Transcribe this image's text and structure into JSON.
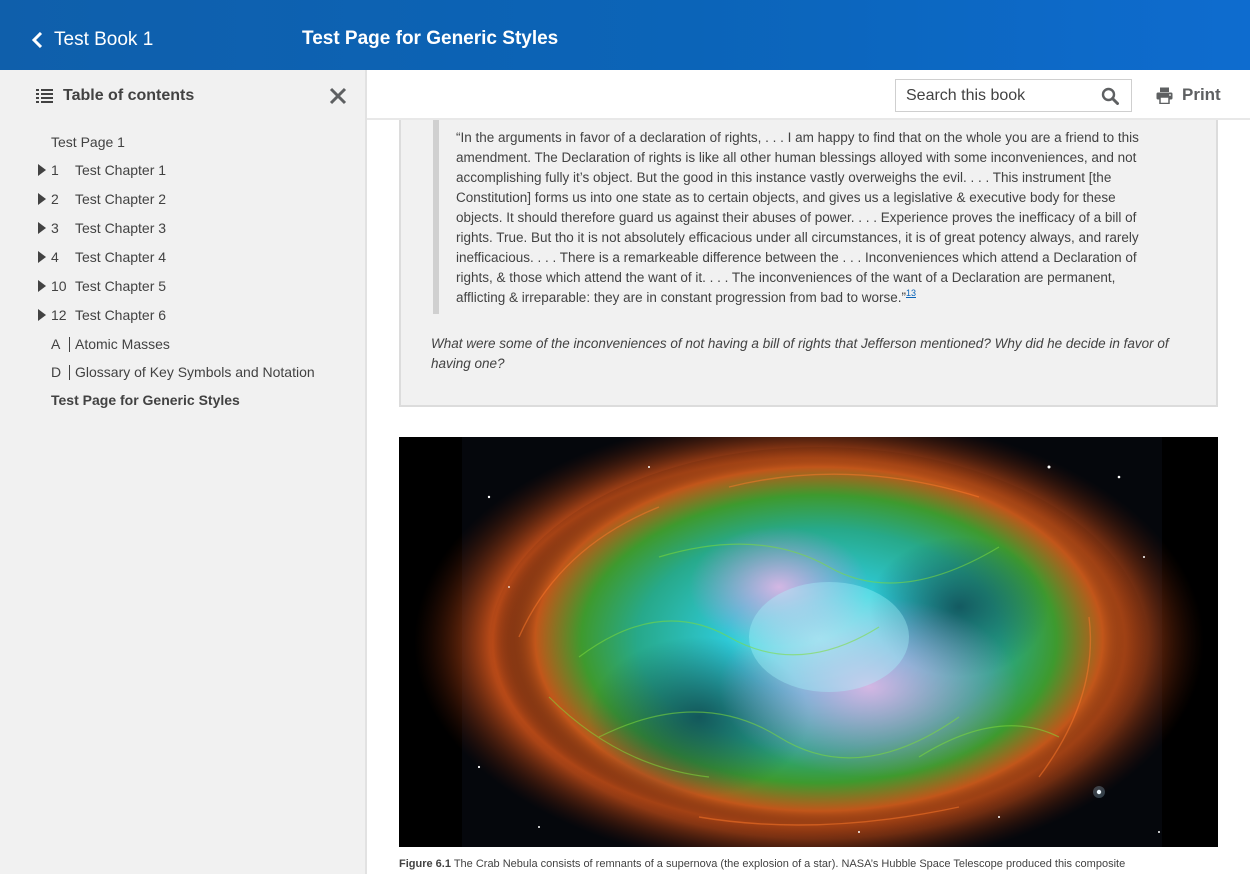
{
  "header": {
    "back_label": "Test Book 1",
    "page_title": "Test Page for Generic Styles"
  },
  "toolbar": {
    "search_placeholder": "Search this book",
    "print_label": "Print"
  },
  "toc": {
    "heading": "Table of contents",
    "items": [
      {
        "kind": "page",
        "label": "Test Page 1"
      },
      {
        "kind": "chapter",
        "number": "1",
        "label": "Test Chapter 1"
      },
      {
        "kind": "chapter",
        "number": "2",
        "label": "Test Chapter 2"
      },
      {
        "kind": "chapter",
        "number": "3",
        "label": "Test Chapter 3"
      },
      {
        "kind": "chapter",
        "number": "4",
        "label": "Test Chapter 4"
      },
      {
        "kind": "chapter",
        "number": "10",
        "label": "Test Chapter 5"
      },
      {
        "kind": "chapter",
        "number": "12",
        "label": "Test Chapter 6"
      },
      {
        "kind": "appendix",
        "number": "A",
        "label": "Atomic Masses"
      },
      {
        "kind": "appendix",
        "number": "D",
        "label": "Glossary of Key Symbols and Notation"
      },
      {
        "kind": "page",
        "label": "Test Page for Generic Styles",
        "active": true
      }
    ]
  },
  "feature": {
    "quote": "“In the arguments in favor of a declaration of rights, . . . I am happy to find that on the whole you are a friend to this amendment. The Declaration of rights is like all other human blessings alloyed with some inconveniences, and not accomplishing fully it’s object. But the good in this instance vastly overweighs the evil. . . . This instrument [the Constitution] forms us into one state as to certain objects, and gives us a legislative & executive body for these objects. It should therefore guard us against their abuses of power. . . . Experience proves the inefficacy of a bill of rights. True. But tho it is not absolutely efficacious under all circumstances, it is of great potency always, and rarely inefficacious. . . . There is a remarkeable difference between the . . . Inconveniences which attend a Declaration of rights, & those which attend the want of it. . . . The inconveniences of the want of a Declaration are permanent, afflicting & irreparable: they are in constant progression from bad to worse.”",
    "footnote": "13",
    "question": "What were some of the inconveniences of not having a bill of rights that Jefferson mentioned? Why did he decide in favor of having one?"
  },
  "figure": {
    "label": "Figure 6.1",
    "caption": " The Crab Nebula consists of remnants of a supernova (the explosion of a star). NASA’s Hubble Space Telescope produced this composite"
  },
  "colors": {
    "header_blue": "#0b64b8",
    "sidebar_bg": "#f1f1f1",
    "text": "#424242",
    "link": "#0b64b8"
  },
  "icons": {
    "back": "chevron-left-icon",
    "toc": "list-icon",
    "close": "close-icon",
    "search": "search-icon",
    "print": "print-icon",
    "expand": "caret-right-icon"
  }
}
